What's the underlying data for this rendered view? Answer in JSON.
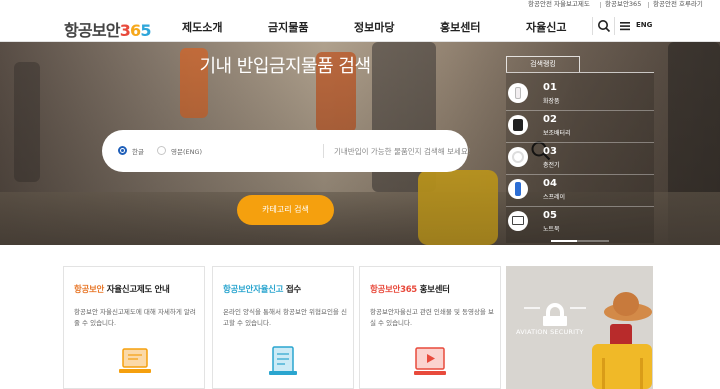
{
  "util_links": [
    "항공안전 자율보고제도",
    "항공보안365",
    "항공안전 호루라기"
  ],
  "logo": {
    "text": "항공보안",
    "digit1": "3",
    "digit2": "6",
    "digit3": "5"
  },
  "nav": [
    "제도소개",
    "금지물품",
    "정보마당",
    "홍보센터",
    "자율신고"
  ],
  "header": {
    "lang": "ENG",
    "search_icon": "search-icon",
    "menu_icon": "hamburger-menu-icon"
  },
  "hero": {
    "title": "기내 반입금지물품 검색",
    "radio_korean": "한글",
    "radio_english": "영문(ENG)",
    "search_placeholder": "기내반입이 가능한 물품인지 검색해 보세요!",
    "category_button": "카테고리 검색"
  },
  "ranking": {
    "tab": "검색랭킹",
    "items": [
      {
        "num": "01",
        "name": "화장품",
        "icon": "cosmetics-icon"
      },
      {
        "num": "02",
        "name": "보조배터리",
        "icon": "battery-icon"
      },
      {
        "num": "03",
        "name": "충전기",
        "icon": "charger-icon"
      },
      {
        "num": "04",
        "name": "스프레이",
        "icon": "spray-icon"
      },
      {
        "num": "05",
        "name": "노트북",
        "icon": "laptop-icon"
      }
    ]
  },
  "cards": [
    {
      "title_highlight": "항공보안",
      "title_rest": " 자율신고제도 안내",
      "desc": "항공보안 자율신고제도에 대해 자세하게 알려줄 수 있습니다.",
      "color": "#e8782a"
    },
    {
      "title_highlight": "항공보안자율신고",
      "title_rest": " 접수",
      "desc": "온라인 양식을 통해서 항공보안 위협요인을 신고할 수 있습니다.",
      "color": "#2aa5cf"
    },
    {
      "title_highlight": "항공보안365",
      "title_rest": " 홍보센터",
      "desc": "항공보안자율신고 관련 인쇄물 및 동영상을 보실 수 있습니다.",
      "color": "#e84a3c"
    }
  ],
  "photo_card": {
    "caption": "AVIATION SECURITY"
  },
  "colors": {
    "accent_orange": "#f5a00e",
    "radio_blue": "#1f5fb9"
  }
}
